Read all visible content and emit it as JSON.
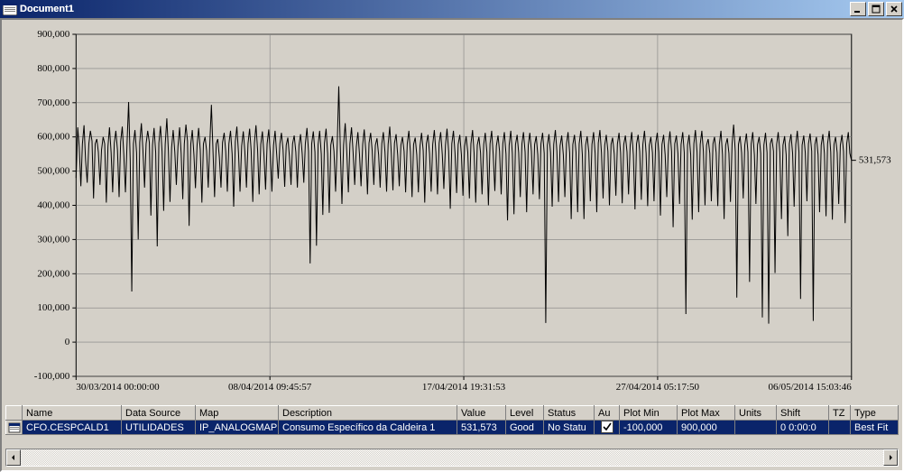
{
  "window": {
    "title": "Document1"
  },
  "grid": {
    "headers": [
      "Name",
      "Data Source",
      "Map",
      "Description",
      "Value",
      "Level",
      "Status",
      "Au",
      "Plot Min",
      "Plot Max",
      "Units",
      "Shift",
      "TZ",
      "Type"
    ],
    "row": {
      "name": "CFO.CESPCALD1",
      "data_source": "UTILIDADES",
      "map": "IP_ANALOGMAP",
      "description": "Consumo Específico da Caldeira 1",
      "value": "531,573",
      "level": "Good",
      "status": "No Statu",
      "au_checked": true,
      "plot_min": "-100,000",
      "plot_max": "900,000",
      "units": "",
      "shift": "0  0:00:0",
      "tz": "",
      "type": "Best Fit"
    }
  },
  "end_label": "531,573",
  "chart_data": {
    "type": "line",
    "title": "",
    "xlabel": "",
    "ylabel": "",
    "ylim": [
      -100000,
      900000
    ],
    "y_ticks": [
      -100000,
      0,
      100000,
      200000,
      300000,
      400000,
      500000,
      600000,
      700000,
      800000,
      900000
    ],
    "y_tick_labels": [
      "-100,000",
      "0",
      "100,000",
      "200,000",
      "300,000",
      "400,000",
      "500,000",
      "600,000",
      "700,000",
      "800,000",
      "900,000"
    ],
    "x_tick_labels": [
      "30/03/2014  00:00:00",
      "08/04/2014  09:45:57",
      "17/04/2014  19:31:53",
      "27/04/2014  05:17:50",
      "06/05/2014  15:03:46"
    ],
    "series": [
      {
        "name": "CFO.CESPCALD1",
        "values": [
          480000,
          628000,
          570000,
          456000,
          580000,
          634000,
          532000,
          466000,
          580000,
          618000,
          588000,
          420000,
          580000,
          594000,
          556000,
          460000,
          562000,
          600000,
          580000,
          408000,
          572000,
          628000,
          554000,
          438000,
          582000,
          618000,
          562000,
          424000,
          586000,
          630000,
          548000,
          438000,
          576000,
          702000,
          530000,
          148000,
          580000,
          620000,
          554000,
          300000,
          584000,
          640000,
          562000,
          452000,
          580000,
          618000,
          584000,
          370000,
          576000,
          626000,
          554000,
          280000,
          582000,
          632000,
          558000,
          384000,
          578000,
          654000,
          560000,
          410000,
          570000,
          620000,
          556000,
          460000,
          572000,
          628000,
          552000,
          418000,
          580000,
          636000,
          588000,
          340000,
          578000,
          620000,
          548000,
          450000,
          576000,
          626000,
          562000,
          408000,
          580000,
          600000,
          560000,
          452000,
          578000,
          694000,
          556000,
          424000,
          580000,
          594000,
          540000,
          452000,
          584000,
          612000,
          558000,
          440000,
          580000,
          618000,
          550000,
          396000,
          586000,
          630000,
          554000,
          440000,
          574000,
          616000,
          558000,
          452000,
          580000,
          624000,
          560000,
          410000,
          582000,
          634000,
          562000,
          432000,
          578000,
          616000,
          548000,
          446000,
          580000,
          622000,
          554000,
          440000,
          576000,
          618000,
          548000,
          478000,
          580000,
          612000,
          562000,
          454000,
          576000,
          598000,
          544000,
          460000,
          580000,
          604000,
          556000,
          452000,
          576000,
          608000,
          552000,
          466000,
          580000,
          626000,
          558000,
          230000,
          580000,
          616000,
          556000,
          282000,
          578000,
          618000,
          550000,
          372000,
          582000,
          624000,
          552000,
          378000,
          576000,
          602000,
          558000,
          440000,
          578000,
          748000,
          558000,
          404000,
          576000,
          640000,
          560000,
          438000,
          580000,
          628000,
          556000,
          460000,
          572000,
          614000,
          548000,
          456000,
          578000,
          622000,
          558000,
          432000,
          582000,
          612000,
          560000,
          460000,
          576000,
          596000,
          548000,
          452000,
          580000,
          614000,
          556000,
          440000,
          578000,
          630000,
          552000,
          444000,
          582000,
          608000,
          546000,
          456000,
          576000,
          600000,
          558000,
          438000,
          580000,
          618000,
          556000,
          424000,
          578000,
          598000,
          548000,
          438000,
          574000,
          612000,
          560000,
          408000,
          580000,
          606000,
          552000,
          440000,
          578000,
          620000,
          556000,
          432000,
          582000,
          614000,
          548000,
          448000,
          576000,
          624000,
          558000,
          390000,
          580000,
          618000,
          554000,
          436000,
          578000,
          606000,
          548000,
          428000,
          572000,
          602000,
          556000,
          420000,
          580000,
          620000,
          552000,
          408000,
          576000,
          600000,
          554000,
          432000,
          578000,
          612000,
          556000,
          400000,
          580000,
          618000,
          548000,
          442000,
          574000,
          604000,
          558000,
          432000,
          580000,
          614000,
          550000,
          356000,
          576000,
          618000,
          552000,
          374000,
          578000,
          606000,
          554000,
          424000,
          580000,
          614000,
          556000,
          380000,
          576000,
          612000,
          558000,
          432000,
          578000,
          602000,
          548000,
          418000,
          580000,
          612000,
          552000,
          56000,
          576000,
          608000,
          554000,
          396000,
          578000,
          620000,
          558000,
          410000,
          574000,
          604000,
          548000,
          424000,
          580000,
          614000,
          554000,
          360000,
          578000,
          606000,
          556000,
          380000,
          580000,
          618000,
          548000,
          360000,
          576000,
          602000,
          556000,
          412000,
          578000,
          614000,
          552000,
          380000,
          582000,
          620000,
          554000,
          420000,
          576000,
          606000,
          558000,
          400000,
          578000,
          598000,
          550000,
          428000,
          580000,
          612000,
          554000,
          406000,
          578000,
          604000,
          556000,
          432000,
          576000,
          614000,
          548000,
          388000,
          580000,
          606000,
          558000,
          416000,
          578000,
          618000,
          552000,
          398000,
          576000,
          600000,
          554000,
          412000,
          580000,
          612000,
          556000,
          370000,
          578000,
          606000,
          548000,
          424000,
          576000,
          616000,
          558000,
          336000,
          580000,
          604000,
          552000,
          404000,
          578000,
          614000,
          554000,
          82000,
          576000,
          606000,
          548000,
          358000,
          580000,
          620000,
          556000,
          380000,
          578000,
          618000,
          558000,
          400000,
          576000,
          594000,
          552000,
          412000,
          580000,
          600000,
          554000,
          398000,
          578000,
          618000,
          548000,
          360000,
          576000,
          596000,
          552000,
          410000,
          580000,
          636000,
          558000,
          130000,
          578000,
          602000,
          554000,
          420000,
          576000,
          610000,
          556000,
          176000,
          580000,
          614000,
          548000,
          404000,
          578000,
          600000,
          552000,
          72000,
          576000,
          612000,
          554000,
          54000,
          580000,
          596000,
          558000,
          202000,
          578000,
          614000,
          556000,
          360000,
          576000,
          602000,
          548000,
          310000,
          580000,
          608000,
          552000,
          396000,
          578000,
          618000,
          556000,
          126000,
          576000,
          604000,
          554000,
          412000,
          580000,
          610000,
          558000,
          62000,
          578000,
          600000,
          548000,
          380000,
          576000,
          608000,
          552000,
          368000,
          580000,
          618000,
          556000,
          358000,
          578000,
          600000,
          554000,
          404000,
          576000,
          606000,
          558000,
          348000,
          580000,
          614000,
          552000,
          531573
        ]
      }
    ]
  }
}
